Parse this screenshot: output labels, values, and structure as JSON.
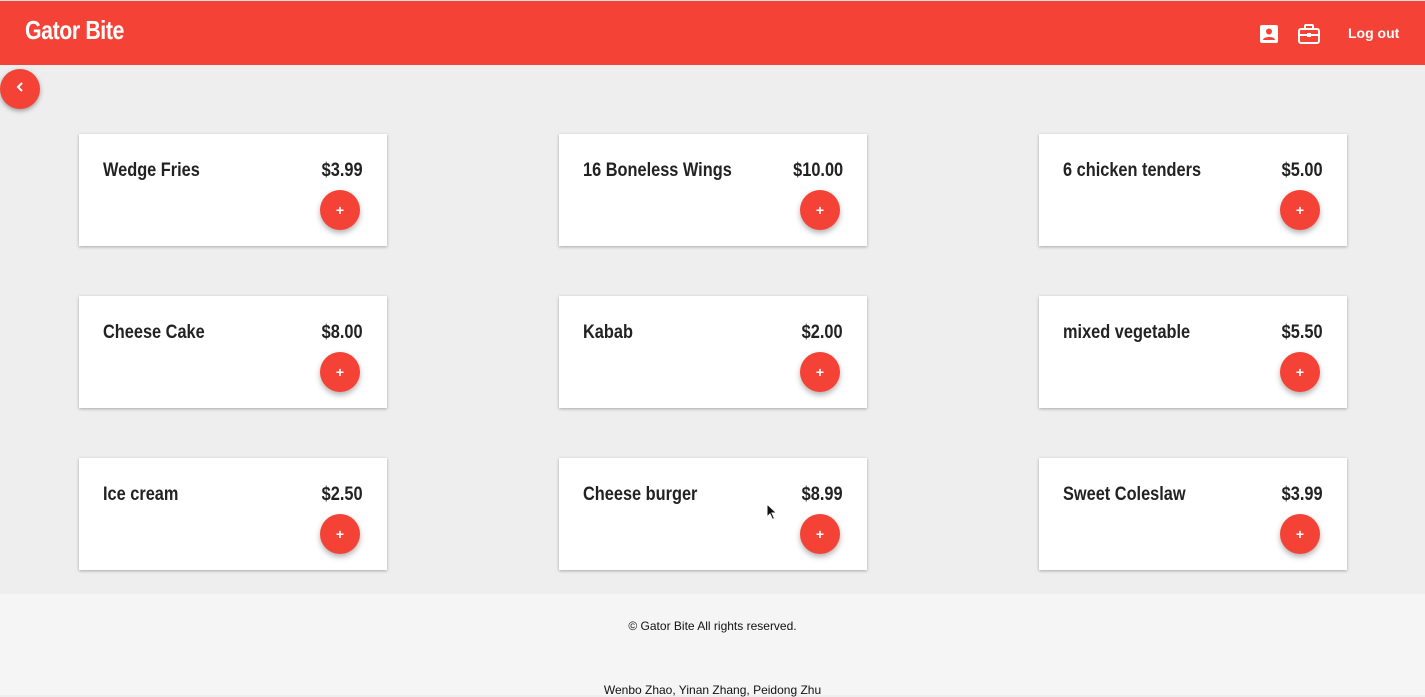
{
  "header": {
    "brand": "Gator Bite",
    "profile_icon": "account-box-icon",
    "orders_icon": "briefcase-icon",
    "logout_label": "Log out"
  },
  "nav": {
    "back_icon": "chevron-left-icon"
  },
  "menu": {
    "items": [
      {
        "name": "Wedge Fries",
        "price": "$3.99",
        "add_label": "+"
      },
      {
        "name": "16 Boneless Wings",
        "price": "$10.00",
        "add_label": "+"
      },
      {
        "name": "6 chicken tenders",
        "price": "$5.00",
        "add_label": "+"
      },
      {
        "name": "Cheese Cake",
        "price": "$8.00",
        "add_label": "+"
      },
      {
        "name": "Kabab",
        "price": "$2.00",
        "add_label": "+"
      },
      {
        "name": "mixed vegetable",
        "price": "$5.50",
        "add_label": "+"
      },
      {
        "name": "Ice cream",
        "price": "$2.50",
        "add_label": "+"
      },
      {
        "name": "Cheese burger",
        "price": "$8.99",
        "add_label": "+"
      },
      {
        "name": "Sweet Coleslaw",
        "price": "$3.99",
        "add_label": "+"
      }
    ]
  },
  "footer": {
    "copyright": "© Gator Bite All rights reserved.",
    "authors": "Wenbo Zhao, Yinan Zhang, Peidong Zhu"
  },
  "colors": {
    "accent": "#f44336",
    "background": "#eeeeee",
    "card": "#ffffff",
    "footer": "#f5f5f5"
  }
}
